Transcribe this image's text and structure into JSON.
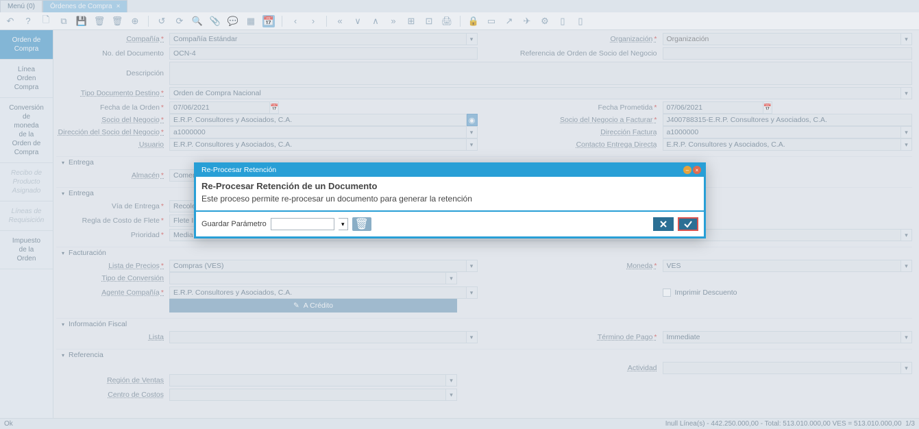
{
  "tabs": {
    "menu": "Menú (0)",
    "active": "Órdenes de Compra"
  },
  "sidebar": {
    "items": [
      {
        "label": "Orden de\nCompra",
        "state": "active"
      },
      {
        "label": "Línea\nOrden\nCompra",
        "state": ""
      },
      {
        "label": "Conversión\nde\nmoneda\nde la\nOrden de\nCompra",
        "state": ""
      },
      {
        "label": "Recibo de Producto Asignado",
        "state": "disabled"
      },
      {
        "label": "Líneas de Requisición",
        "state": "disabled"
      },
      {
        "label": "Impuesto\nde la\nOrden",
        "state": ""
      }
    ]
  },
  "labels": {
    "compania": "Compañía",
    "organizacion": "Organización",
    "no_documento": "No. del Documento",
    "referencia": "Referencia de Orden de Socio del Negocio",
    "descripcion": "Descripción",
    "tipo_doc": "Tipo Documento Destino",
    "fecha_orden": "Fecha de la Orden",
    "fecha_prometida": "Fecha Prometida",
    "socio": "Socio del Negocio",
    "socio_fact": "Socio del Negocio a Facturar",
    "dir_socio": "Dirección del Socio del Negocio",
    "dir_fact": "Dirección Factura",
    "usuario": "Usuario",
    "contacto": "Contacto Entrega Directa",
    "almacen": "Almacén",
    "via": "Vía de Entrega",
    "regla": "Regla de Costo de Flete",
    "prioridad": "Prioridad",
    "lista_precios": "Lista de Precios",
    "moneda": "Moneda",
    "tipo_conv": "Tipo de Conversión",
    "agente": "Agente Compañía",
    "imprimir": "Imprimir Descuento",
    "a_credito": "A Crédito",
    "lista": "Lista",
    "termino": "Término de Pago",
    "actividad": "Actividad",
    "region": "Región de Ventas",
    "centro": "Centro de Costos"
  },
  "values": {
    "compania": "Compañía Estándar",
    "organizacion_ph": "Organización",
    "no_documento": "OCN-4",
    "tipo_doc": "Orden de Compra Nacional",
    "fecha_orden": "07/06/2021",
    "fecha_prometida": "07/06/2021",
    "socio": "E.R.P. Consultores y Asociados, C.A.",
    "socio_fact": "J400788315-E.R.P. Consultores y Asociados, C.A.",
    "dir_socio": "a1000000",
    "dir_fact": "a1000000",
    "usuario": "E.R.P. Consultores y Asociados, C.A.",
    "contacto": "E.R.P. Consultores y Asociados, C.A.",
    "almacen": "Comerc",
    "via": "Recolecc",
    "regla": "Flete Incl",
    "prioridad": "Media",
    "lista_precios": "Compras (VES)",
    "moneda": "VES",
    "agente": "E.R.P. Consultores y Asociados, C.A.",
    "termino": "Immediate"
  },
  "sections": {
    "entrega": "Entrega",
    "entrega2": "Entrega",
    "facturacion": "Facturación",
    "fiscal": "Información Fiscal",
    "referencia": "Referencia"
  },
  "modal": {
    "title": "Re-Procesar Retención",
    "heading": "Re-Procesar Retención de un Documento",
    "text": "Este proceso permite re-procesar un documento para generar la retención",
    "save_param": "Guardar Parámetro"
  },
  "status": {
    "left": "Ok",
    "right": "Inull Línea(s) - 442.250.000,00 - Total: 513.010.000,00 VES = 513.010.000,00",
    "page": "1/3"
  }
}
